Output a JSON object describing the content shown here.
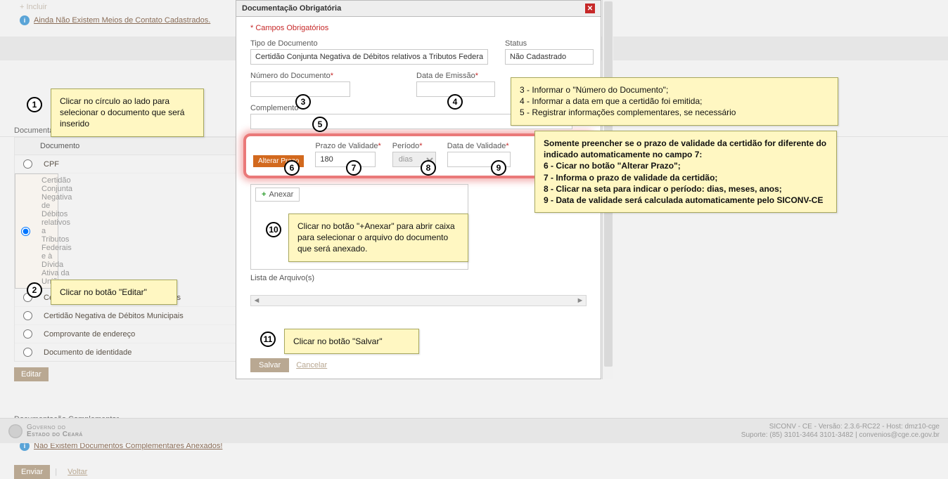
{
  "page": {
    "incluir_label": "+ Incluir",
    "info_contato": "Ainda Não Existem Meios de Contato Cadastrados.",
    "sec_doc_obrig": "Documentação Obrigatória",
    "table_header": "Documento",
    "docs": [
      "CPF",
      "Certidão Conjunta Negativa de Débitos relativos a Tributos Federais e à Dívida Ativa da União",
      "Certidão Negativa de Débitos Estaduais",
      "Certidão Negativa de Débitos Municipais",
      "Comprovante de endereço",
      "Documento de identidade"
    ],
    "selected_doc_index": 1,
    "editar_label": "Editar",
    "sec_doc_comp": "Documentação Complementar",
    "info_comp": "Não Existem Documentos Complementares Anexados!",
    "enviar_label": "Enviar",
    "voltar_label": "Voltar"
  },
  "modal": {
    "title": "Documentação Obrigatória",
    "campos_ob": "* Campos Obrigatórios",
    "tipo_label": "Tipo de Documento",
    "tipo_value": "Certidão Conjunta Negativa de Débitos relativos a Tributos Federais",
    "status_label": "Status",
    "status_value": "Não Cadastrado",
    "num_label": "Número do Documento",
    "emissao_label": "Data de Emissão",
    "complemento_label": "Complemento",
    "alterar_label": "Alterar Prazo",
    "prazo_label": "Prazo de Validade",
    "prazo_value": "180",
    "periodo_label": "Período",
    "periodo_value": "dias",
    "data_val_label": "Data de Validade",
    "anexar_label": "Anexar",
    "lista_label": "Lista de Arquivo(s)",
    "salvar_label": "Salvar",
    "cancelar_label": "Cancelar"
  },
  "callouts": {
    "c1": "Clicar no círculo ao lado para selecionar o documento que será inserido",
    "c2": "Clicar no botão \"Editar\"",
    "c345_l1": "3 - Informar o \"Número do Documento\";",
    "c345_l2": "4 - Informar a data em que a certidão foi emitida;",
    "c345_l3": "5 - Registrar informações complementares, se necessário",
    "c6789_l1": "Somente preencher se o prazo de validade da certidão for diferente do indicado automaticamente no campo 7:",
    "c6789_l2": "6 - Cicar no botão \"Alterar Prazo\";",
    "c6789_l3": "7 - Informa o prazo de validade da certidão;",
    "c6789_l4": "8 - Clicar na seta para indicar o período: dias, meses, anos;",
    "c6789_l5": "9 - Data de validade será calculada automaticamente pelo SICONV-CE",
    "c10_l1": "Clicar no botão \"+Anexar\" para abrir caixa para selecionar o arquivo do documento que será anexado.",
    "c11": "Clicar no botão \"Salvar\""
  },
  "footer": {
    "gov1": "Governo do",
    "gov2": "Estado do Ceará",
    "right1": "SICONV - CE - Versão: 2.3.6-RC22 - Host: dmz10-cge",
    "right2": "Suporte: (85) 3101-3464  3101-3482 | convenios@cge.ce.gov.br"
  }
}
